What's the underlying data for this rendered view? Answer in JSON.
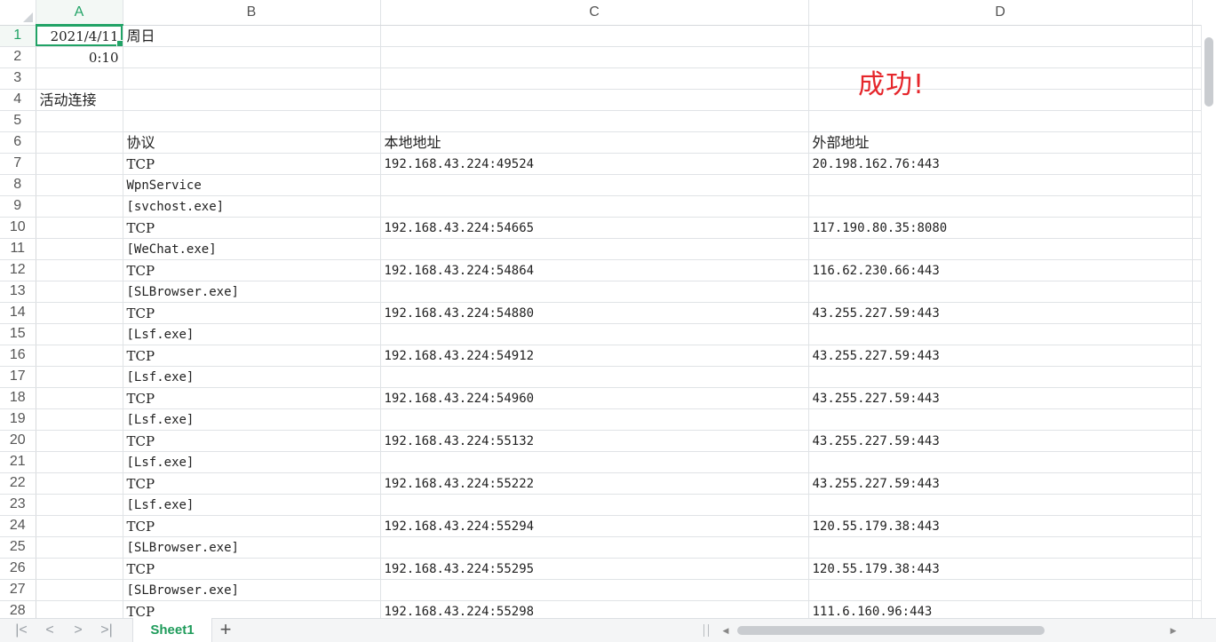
{
  "columns": [
    "A",
    "B",
    "C",
    "D"
  ],
  "rows": [
    {
      "n": "1",
      "a": "2021/4/11",
      "b": "周日",
      "c": "",
      "d": ""
    },
    {
      "n": "2",
      "a": "0:10",
      "b": "",
      "c": "",
      "d": ""
    },
    {
      "n": "3",
      "a": "",
      "b": "",
      "c": "",
      "d": ""
    },
    {
      "n": "4",
      "a": "活动连接",
      "b": "",
      "c": "",
      "d": ""
    },
    {
      "n": "5",
      "a": "",
      "b": "",
      "c": "",
      "d": ""
    },
    {
      "n": "6",
      "a": "",
      "b": "协议",
      "c": "本地地址",
      "d": "外部地址"
    },
    {
      "n": "7",
      "a": "",
      "b": "TCP",
      "c": "192.168.43.224:49524",
      "d": "20.198.162.76:443"
    },
    {
      "n": "8",
      "a": "",
      "b": "WpnService",
      "c": "",
      "d": ""
    },
    {
      "n": "9",
      "a": "",
      "b": "[svchost.exe]",
      "c": "",
      "d": ""
    },
    {
      "n": "10",
      "a": "",
      "b": "TCP",
      "c": "192.168.43.224:54665",
      "d": "117.190.80.35:8080"
    },
    {
      "n": "11",
      "a": "",
      "b": "[WeChat.exe]",
      "c": "",
      "d": ""
    },
    {
      "n": "12",
      "a": "",
      "b": "TCP",
      "c": "192.168.43.224:54864",
      "d": "116.62.230.66:443"
    },
    {
      "n": "13",
      "a": "",
      "b": "[SLBrowser.exe]",
      "c": "",
      "d": ""
    },
    {
      "n": "14",
      "a": "",
      "b": "TCP",
      "c": "192.168.43.224:54880",
      "d": "43.255.227.59:443"
    },
    {
      "n": "15",
      "a": "",
      "b": "[Lsf.exe]",
      "c": "",
      "d": ""
    },
    {
      "n": "16",
      "a": "",
      "b": "TCP",
      "c": "192.168.43.224:54912",
      "d": "43.255.227.59:443"
    },
    {
      "n": "17",
      "a": "",
      "b": "[Lsf.exe]",
      "c": "",
      "d": ""
    },
    {
      "n": "18",
      "a": "",
      "b": "TCP",
      "c": "192.168.43.224:54960",
      "d": "43.255.227.59:443"
    },
    {
      "n": "19",
      "a": "",
      "b": "[Lsf.exe]",
      "c": "",
      "d": ""
    },
    {
      "n": "20",
      "a": "",
      "b": "TCP",
      "c": "192.168.43.224:55132",
      "d": "43.255.227.59:443"
    },
    {
      "n": "21",
      "a": "",
      "b": "[Lsf.exe]",
      "c": "",
      "d": ""
    },
    {
      "n": "22",
      "a": "",
      "b": "TCP",
      "c": "192.168.43.224:55222",
      "d": "43.255.227.59:443"
    },
    {
      "n": "23",
      "a": "",
      "b": "[Lsf.exe]",
      "c": "",
      "d": ""
    },
    {
      "n": "24",
      "a": "",
      "b": "TCP",
      "c": "192.168.43.224:55294",
      "d": "120.55.179.38:443"
    },
    {
      "n": "25",
      "a": "",
      "b": "[SLBrowser.exe]",
      "c": "",
      "d": ""
    },
    {
      "n": "26",
      "a": "",
      "b": "TCP",
      "c": "192.168.43.224:55295",
      "d": "120.55.179.38:443"
    },
    {
      "n": "27",
      "a": "",
      "b": "[SLBrowser.exe]",
      "c": "",
      "d": ""
    },
    {
      "n": "28",
      "a": "",
      "b": "TCP",
      "c": "192.168.43.224:55298",
      "d": "111.6.160.96:443"
    }
  ],
  "floating_text": "成功!",
  "tabs": {
    "active_sheet": "Sheet1",
    "add_label": "+",
    "nav_first": "|<",
    "nav_prev": "<",
    "nav_next": ">",
    "nav_last": ">|"
  },
  "colors": {
    "accent": "#21a366",
    "success_text": "#e5262b",
    "gridline": "#e0e3e6"
  }
}
